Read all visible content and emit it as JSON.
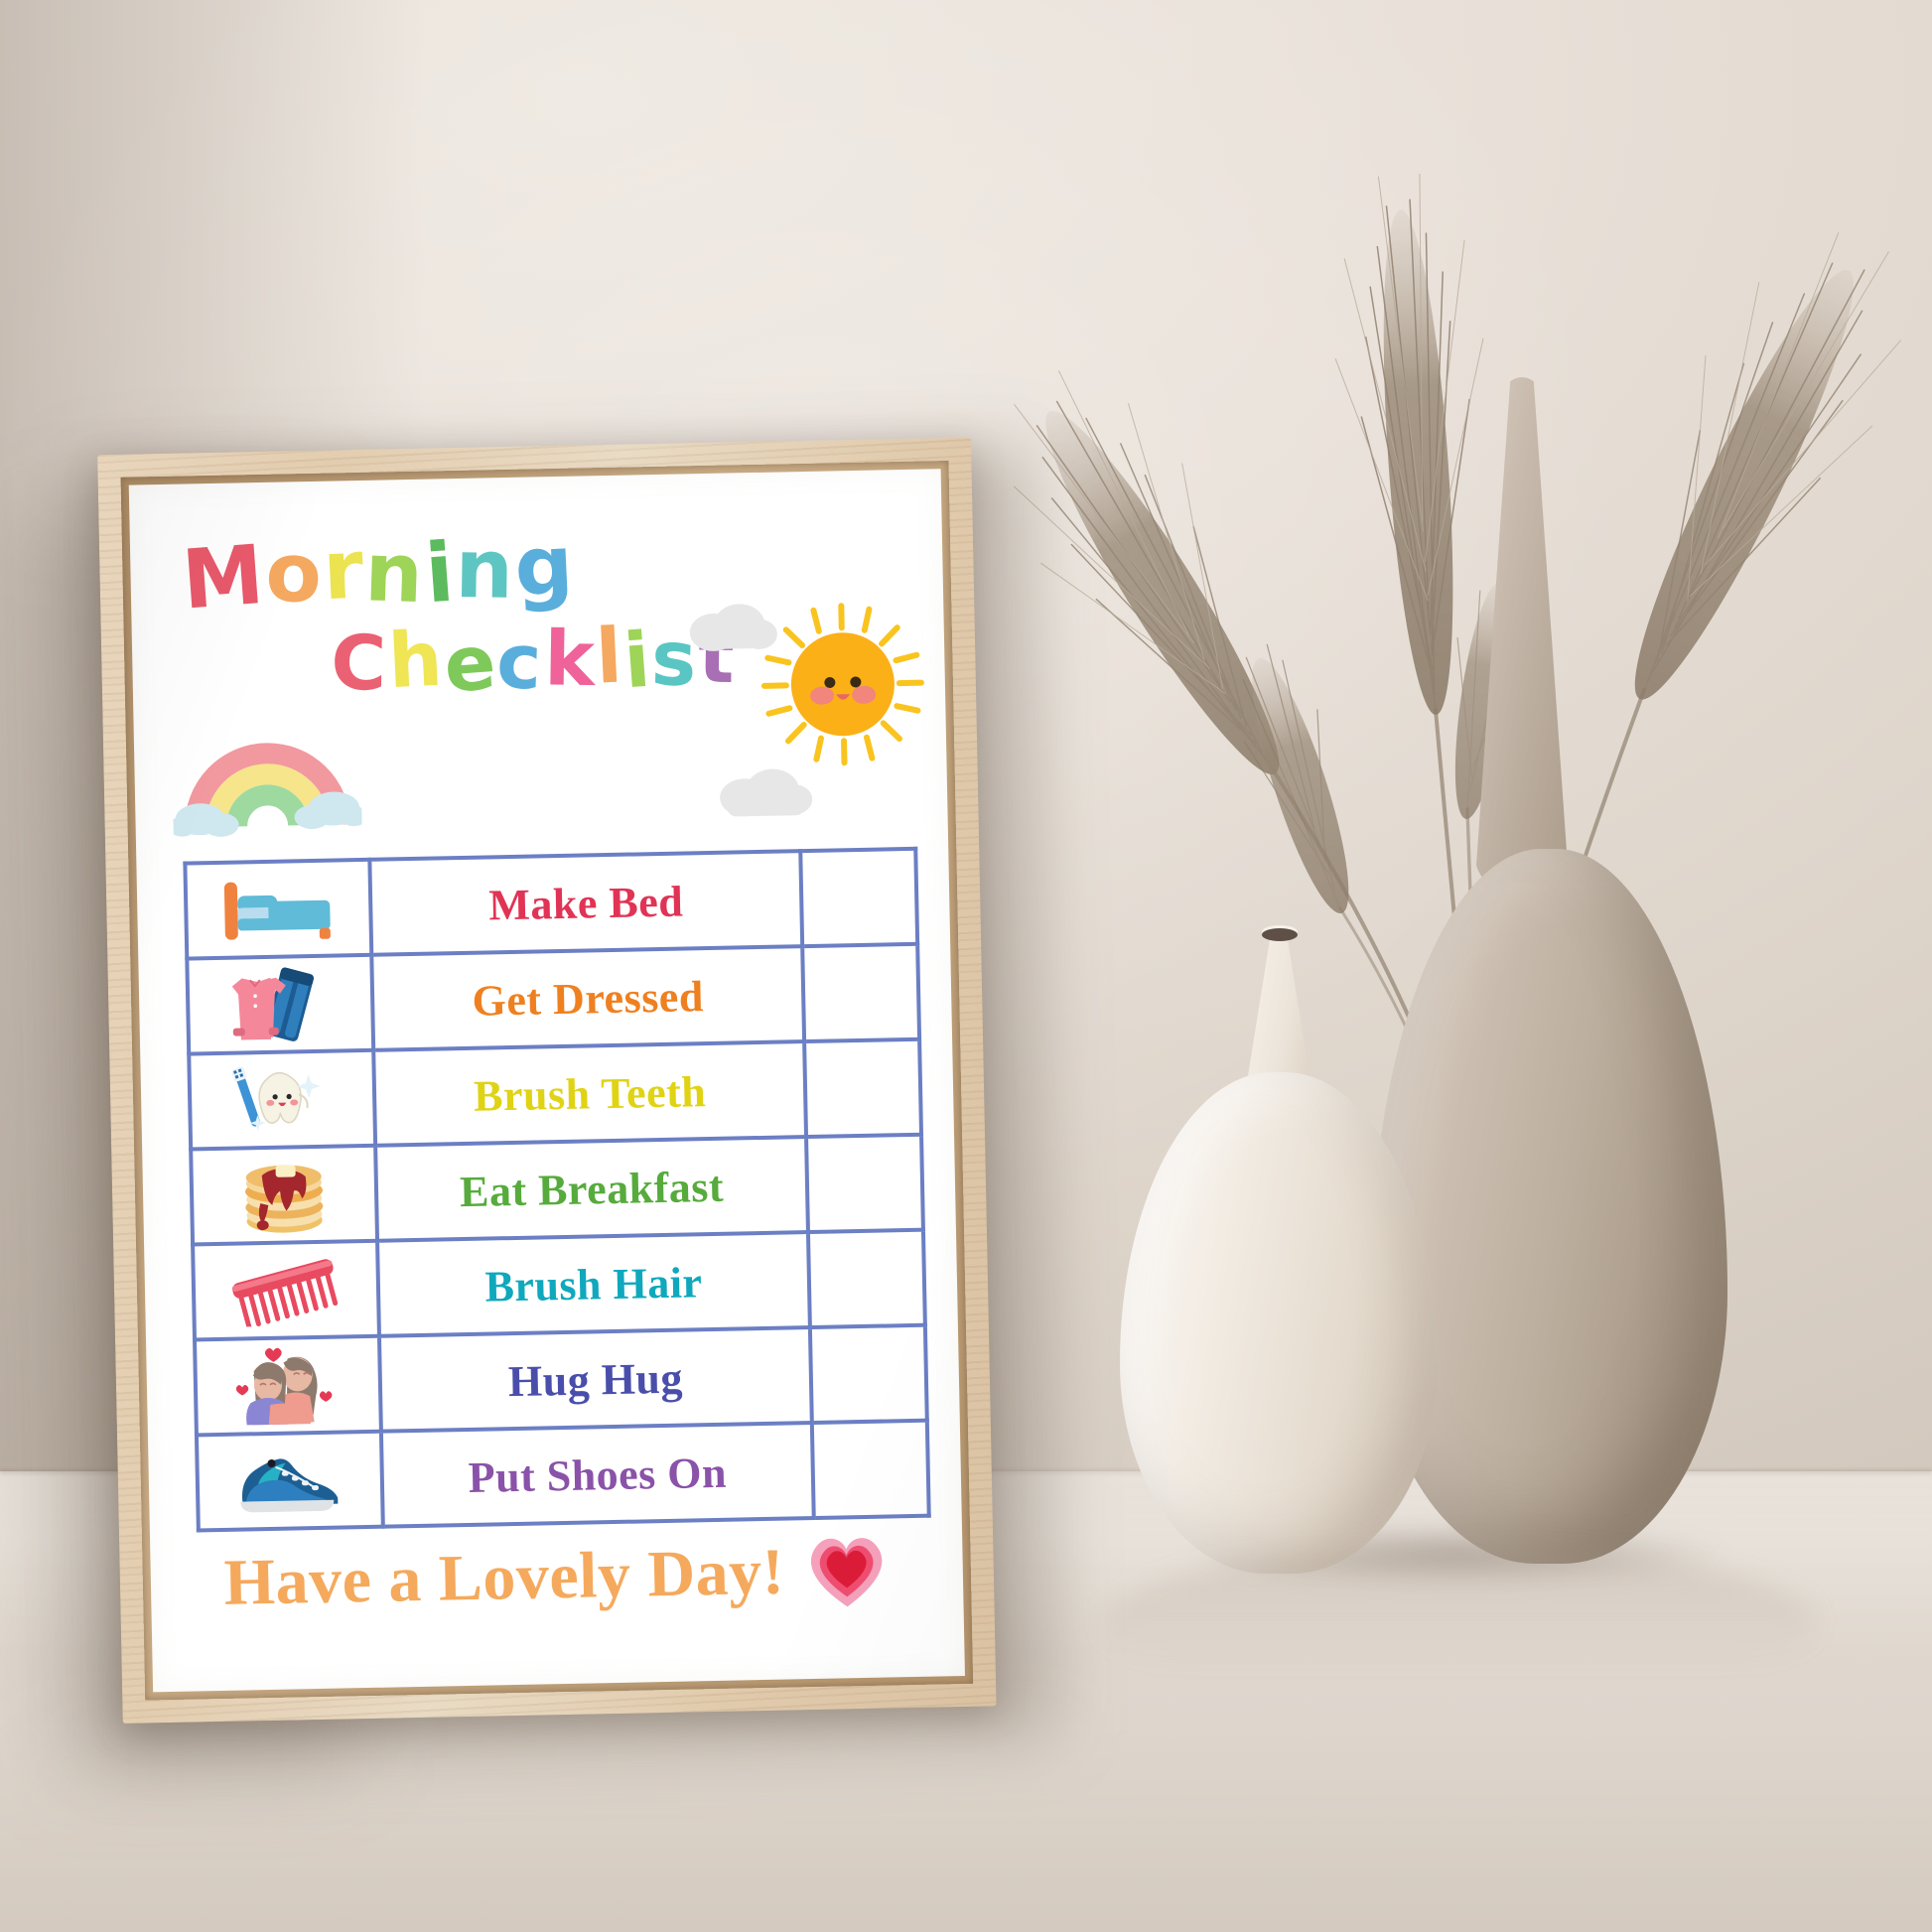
{
  "scene": {
    "description": "Framed kids morning checklist poster leaning against a beige wall beside two ceramic vases with dried pampas grass",
    "wall_color": "#e5ddd4",
    "floor_color": "#ded6cd",
    "frame_color": "#e3cdb0"
  },
  "poster": {
    "background": "#ffffff",
    "title": {
      "line1": "Morning",
      "line2": "Checklist",
      "line1_letters": [
        {
          "char": "M",
          "color": "#e8596b"
        },
        {
          "char": "o",
          "color": "#f5a85f"
        },
        {
          "char": "r",
          "color": "#ebe350"
        },
        {
          "char": "n",
          "color": "#9ed457"
        },
        {
          "char": "i",
          "color": "#5cbb5e"
        },
        {
          "char": "n",
          "color": "#5ec6c2"
        },
        {
          "char": "g",
          "color": "#5aaedb"
        }
      ],
      "line2_letters": [
        {
          "char": "C",
          "color": "#ea6173"
        },
        {
          "char": "h",
          "color": "#efe555"
        },
        {
          "char": "e",
          "color": "#7ec95a"
        },
        {
          "char": "c",
          "color": "#5aaedb"
        },
        {
          "char": "k",
          "color": "#f0629a"
        },
        {
          "char": "l",
          "color": "#f5a85f"
        },
        {
          "char": "i",
          "color": "#9ed457"
        },
        {
          "char": "s",
          "color": "#59c6c3"
        },
        {
          "char": "t",
          "color": "#a86fb5"
        }
      ]
    },
    "decorations": {
      "rainbow": {
        "name": "rainbow-icon",
        "arc_colors": [
          "#f2989f",
          "#f6e58a",
          "#9ed9a0"
        ],
        "cloud_color": "#cfe7ee"
      },
      "sun": {
        "name": "sun-icon",
        "body_color": "#fbb018",
        "ray_color": "#f9c41f",
        "cheek_color": "#f2857c",
        "face_color": "#3b2a14"
      },
      "cloud_top": {
        "name": "cloud-icon",
        "color": "#e6e6e6"
      },
      "cloud_mid": {
        "name": "cloud-icon",
        "color": "#e6e6e6"
      },
      "heart": {
        "name": "heart-icon",
        "outer": "#f5a1bb",
        "middle": "#ef4d70",
        "inner": "#dc1c38"
      }
    },
    "table": {
      "border_color": "#6b7fc4",
      "columns": [
        "icon",
        "task",
        "checkbox"
      ],
      "rows": [
        {
          "icon": "bed-icon",
          "task": "Make Bed",
          "color": "#e13355",
          "checked": false
        },
        {
          "icon": "clothes-icon",
          "task": "Get Dressed",
          "color": "#ef8020",
          "checked": false
        },
        {
          "icon": "tooth-toothbrush-icon",
          "task": "Brush Teeth",
          "color": "#e0d314",
          "checked": false
        },
        {
          "icon": "pancakes-icon",
          "task": "Eat Breakfast",
          "color": "#56ab3c",
          "checked": false
        },
        {
          "icon": "comb-icon",
          "task": "Brush Hair",
          "color": "#0fa8bd",
          "checked": false
        },
        {
          "icon": "hug-icon",
          "task": "Hug Hug",
          "color": "#4a4eab",
          "checked": false
        },
        {
          "icon": "shoes-icon",
          "task": "Put Shoes On",
          "color": "#8a52a8",
          "checked": false
        }
      ]
    },
    "footer": {
      "text": "Have a Lovely Day!",
      "color": "#f5a95c",
      "heart_icon": "heart-icon"
    }
  },
  "objects": {
    "vase_large": {
      "name": "large-taupe-vase",
      "color": "#b5a796"
    },
    "vase_small": {
      "name": "small-white-vase",
      "color": "#f4efe7"
    },
    "pampas": {
      "name": "dried-pampas-grass",
      "color": "#9c8d7d",
      "stem_count": 5
    }
  }
}
